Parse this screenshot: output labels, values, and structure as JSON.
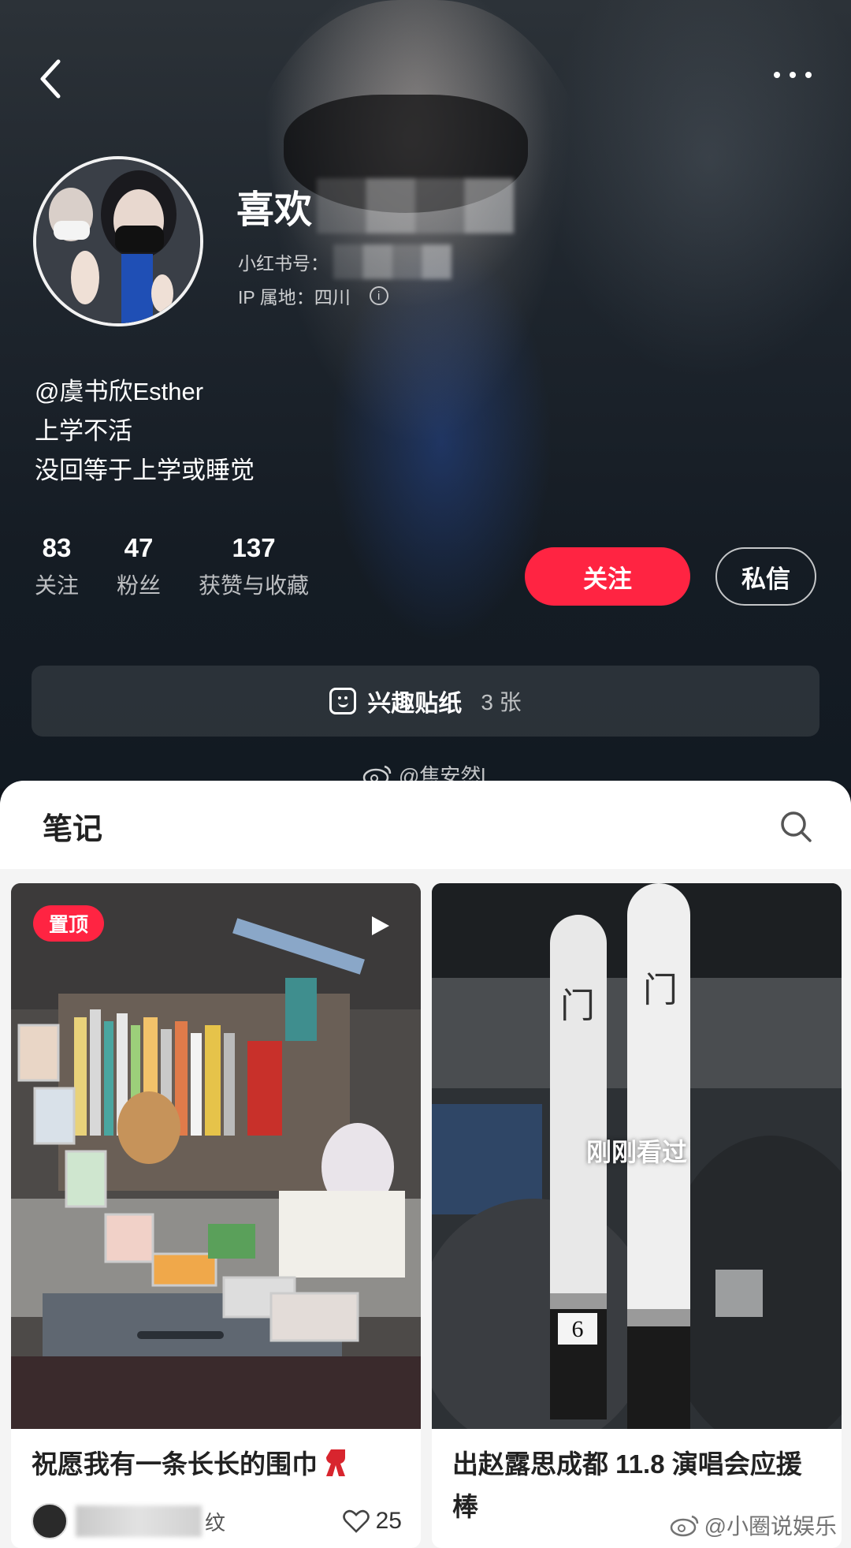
{
  "profile": {
    "name_visible": "喜欢",
    "xhs_id_label": "小红书号：",
    "ip_label": "IP 属地：四川",
    "bio_lines": [
      "@虞书欣Esther",
      "上学不活",
      "没回等于上学或睡觉"
    ],
    "stats": [
      {
        "num": "83",
        "label": "关注"
      },
      {
        "num": "47",
        "label": "粉丝"
      },
      {
        "num": "137",
        "label": "获赞与收藏"
      }
    ],
    "follow_label": "关注",
    "message_label": "私信",
    "sticker_label": "兴趣贴纸",
    "sticker_count": "3 张",
    "watermark_top": "@焦安然l"
  },
  "notes": {
    "title": "笔记",
    "cards": [
      {
        "badge": "置顶",
        "title": "祝愿我有一条长长的围巾",
        "author_suffix": "纹",
        "likes": "25",
        "overlay_text": ""
      },
      {
        "badge": "",
        "title": "出赵露思成都 11.8 演唱会应援棒",
        "author_suffix": "",
        "likes": "",
        "overlay_text": "刚刚看过"
      }
    ]
  },
  "watermark_bottom": "@小圈说娱乐",
  "colors": {
    "accent": "#ff2442",
    "header_bg": "#1d242c"
  }
}
